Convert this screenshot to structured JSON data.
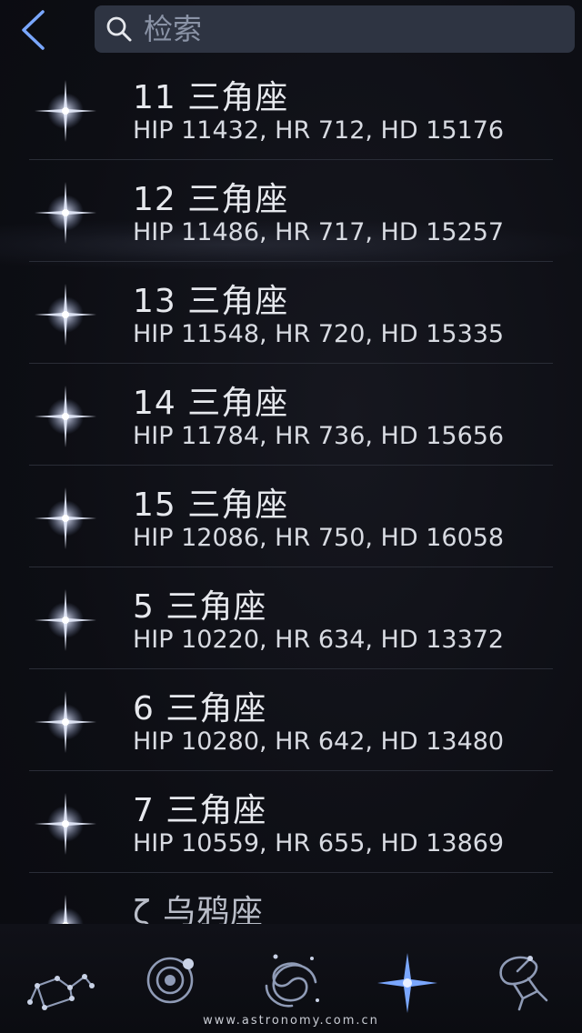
{
  "header": {
    "back_icon": "chevron-left-icon",
    "search": {
      "placeholder": "检索",
      "value": "",
      "icon": "search-icon"
    }
  },
  "list": {
    "items": [
      {
        "title": "11 三角座",
        "sub": "HIP 11432, HR 712, HD 15176",
        "icon": "star-icon"
      },
      {
        "title": "12 三角座",
        "sub": "HIP 11486, HR 717, HD 15257",
        "icon": "star-icon"
      },
      {
        "title": "13 三角座",
        "sub": "HIP 11548, HR 720, HD 15335",
        "icon": "star-icon"
      },
      {
        "title": "14 三角座",
        "sub": "HIP 11784, HR 736, HD 15656",
        "icon": "star-icon"
      },
      {
        "title": "15 三角座",
        "sub": "HIP 12086, HR 750, HD 16058",
        "icon": "star-icon"
      },
      {
        "title": "5 三角座",
        "sub": "HIP 10220, HR 634, HD 13372",
        "icon": "star-icon"
      },
      {
        "title": "6 三角座",
        "sub": "HIP 10280, HR 642, HD 13480",
        "icon": "star-icon"
      },
      {
        "title": "7 三角座",
        "sub": "HIP 10559, HR 655, HD 13869",
        "icon": "star-icon"
      },
      {
        "title": "ζ 乌鸦座",
        "sub": "",
        "icon": "star-icon"
      }
    ]
  },
  "tabbar": {
    "tabs": [
      {
        "name": "constellations",
        "icon": "constellation-icon",
        "active": false
      },
      {
        "name": "solar-system",
        "icon": "planet-orbit-icon",
        "active": false
      },
      {
        "name": "deep-sky",
        "icon": "galaxy-icon",
        "active": false
      },
      {
        "name": "stars",
        "icon": "star-icon",
        "active": true
      },
      {
        "name": "satellites",
        "icon": "satellite-dish-icon",
        "active": false
      }
    ]
  },
  "watermark": "www.astronomy.com.cn",
  "colors": {
    "background": "#0d0e14",
    "search_bg": "#2e3442",
    "accent": "#7aa7ff",
    "text": "#e6e8ed",
    "divider": "#2a2d37"
  }
}
